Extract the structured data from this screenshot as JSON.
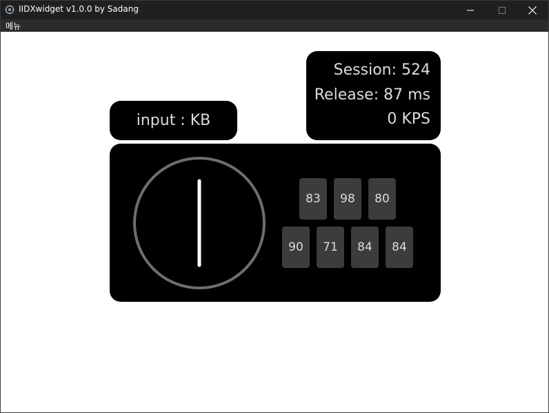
{
  "window": {
    "title": "IIDXwidget v1.0.0 by Sadang",
    "controls": [
      "minimize-icon",
      "maximize-icon",
      "close-icon"
    ]
  },
  "menubar": {
    "items": [
      "메뉴"
    ]
  },
  "input_panel": {
    "text": "input : KB"
  },
  "stats": {
    "session": "Session: 524",
    "release": "Release: 87 ms",
    "kps": "0 KPS"
  },
  "keys": {
    "key1": "90",
    "key2": "83",
    "key3": "71",
    "key4": "98",
    "key5": "84",
    "key6": "80",
    "key7": "84"
  },
  "colors": {
    "panel_bg": "#000000",
    "key_bg": "#3c3c3c",
    "text": "#dcdcdc",
    "turntable_ring": "#6e6e6e",
    "turntable_indicator": "#ffffff"
  }
}
